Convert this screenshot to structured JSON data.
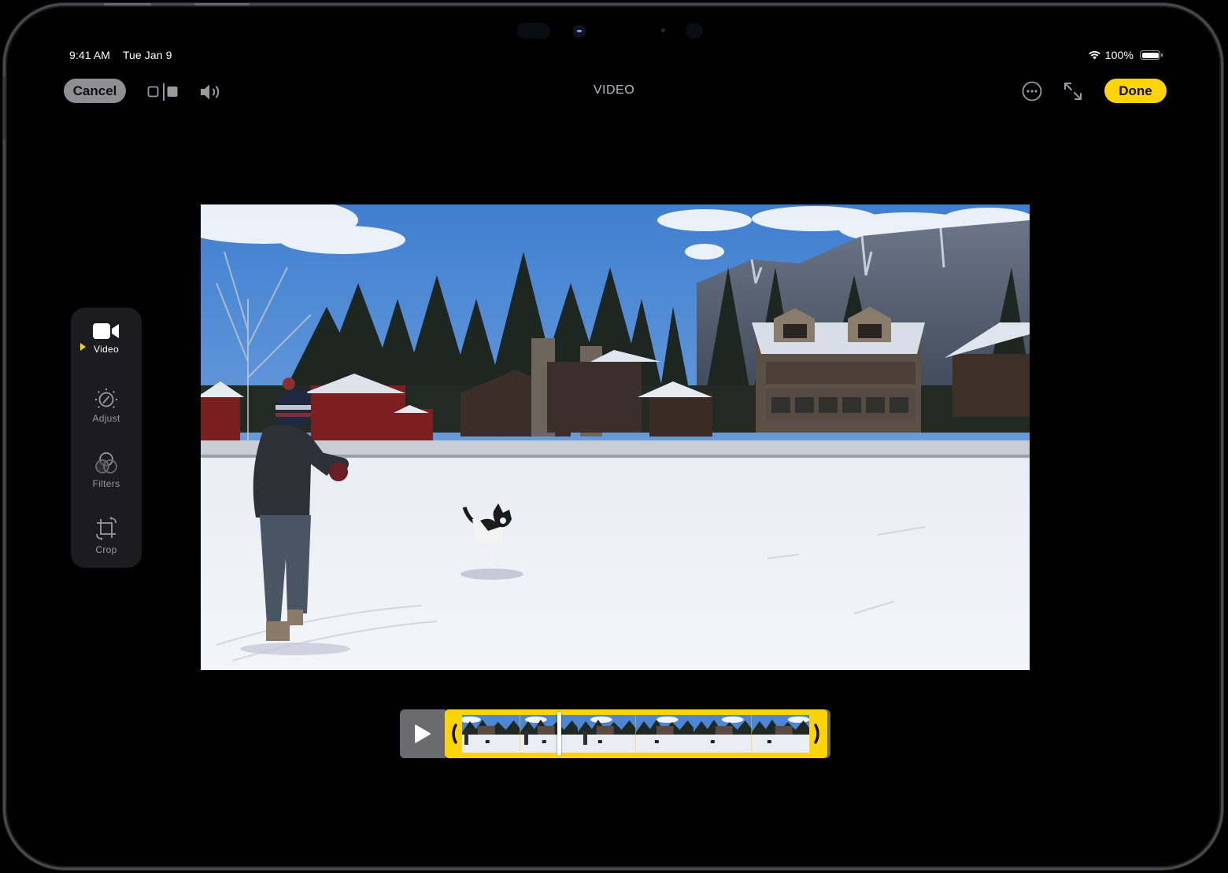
{
  "status_bar": {
    "time": "9:41 AM",
    "date": "Tue Jan 9",
    "wifi_icon": "wifi-icon",
    "battery_percent": "100%",
    "battery_level": 1.0
  },
  "toolbar": {
    "cancel_label": "Cancel",
    "compare_icon": "before-after-compare-icon",
    "sound_icon": "speaker-volume-icon",
    "title": "VIDEO",
    "more_icon": "ellipsis-circle-icon",
    "expand_icon": "expand-arrows-icon",
    "done_label": "Done"
  },
  "sidebar": {
    "items": [
      {
        "label": "Video",
        "icon": "video-camera-icon",
        "active": true
      },
      {
        "label": "Adjust",
        "icon": "adjust-dial-icon",
        "active": false
      },
      {
        "label": "Filters",
        "icon": "filters-circles-icon",
        "active": false
      },
      {
        "label": "Crop",
        "icon": "crop-rotate-icon",
        "active": false
      }
    ]
  },
  "video": {
    "description": "Person and black-and-white dog playing in snow in front of houses, pine trees and snowy mountains"
  },
  "timeline": {
    "play_icon": "play-icon",
    "trim_start_icon": "chevron-left-icon",
    "trim_end_icon": "chevron-right-icon",
    "playhead_position": 0.28,
    "thumbnail_count": 6,
    "colors": {
      "trim_accent": "#fed409",
      "play_bg": "#6b6b6f"
    }
  },
  "colors": {
    "accent_yellow": "#fed409",
    "cancel_bg": "#8e8e93",
    "sidebar_bg": "#1c1c1e",
    "background": "#000000"
  }
}
